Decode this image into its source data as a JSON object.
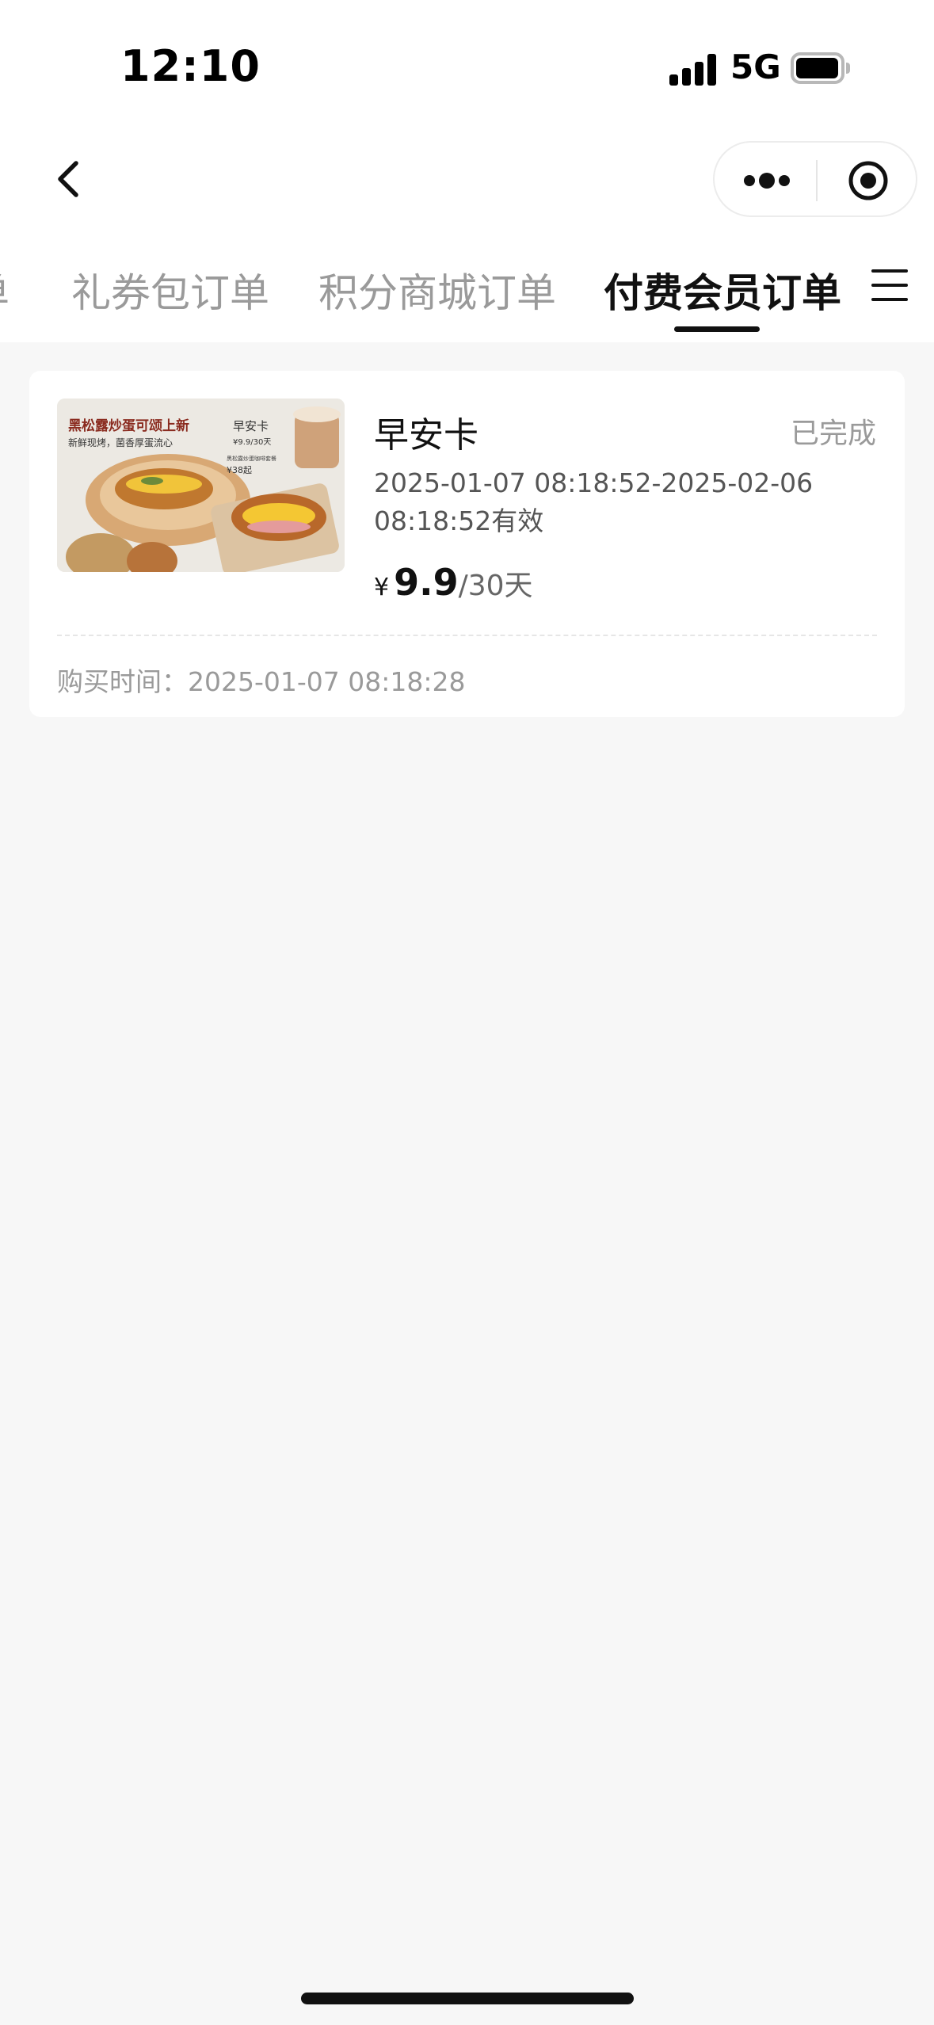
{
  "status_bar": {
    "time": "12:10",
    "network": "5G"
  },
  "tabs": [
    {
      "label": "单"
    },
    {
      "label": "礼券包订单"
    },
    {
      "label": "积分商城订单"
    },
    {
      "label": "付费会员订单",
      "active": true
    }
  ],
  "order": {
    "title": "早安卡",
    "status": "已完成",
    "validity": "2025-01-07 08:18:52-2025-02-06 08:18:52有效",
    "price_symbol": "¥",
    "price_value": "9.9",
    "price_unit": "/30天",
    "purchase_label": "购买时间：",
    "purchase_time": "2025-01-07 08:18:28",
    "image": {
      "headline": "黑松露炒蛋可颂上新",
      "subline": "新鲜现烤，菌香厚蛋流心",
      "card_name": "早安卡",
      "card_price": "¥9.9/30天",
      "bundle_note": "黑松露炒蛋咖啡套餐",
      "bundle_price": "¥38起"
    }
  },
  "colors": {
    "accent": "#111111",
    "muted": "#9a9a9a",
    "background": "#f7f7f7",
    "headline_red": "#8a2b1f"
  },
  "icons": {
    "back": "chevron-left-icon",
    "more": "more-dots-icon",
    "close": "target-circle-icon",
    "menu": "hamburger-menu-icon"
  }
}
